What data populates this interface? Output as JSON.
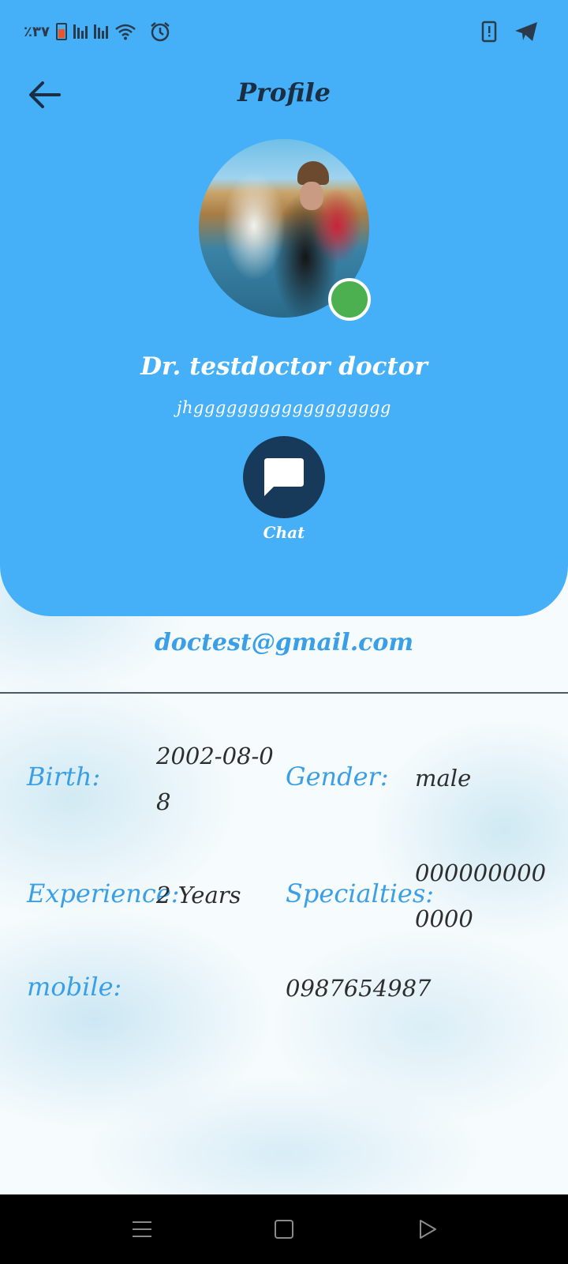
{
  "status_bar": {
    "battery_text": "٪۳۷",
    "icons": [
      "battery-icon",
      "signal-icon",
      "signal-icon",
      "wifi-icon",
      "alarm-icon",
      "phone-alert-icon",
      "telegram-icon"
    ]
  },
  "header": {
    "title": "Profile",
    "back_icon": "arrow-left-icon"
  },
  "profile": {
    "name": "Dr. testdoctor doctor",
    "bio": "jhgggggggggggggggggg",
    "online_status_color": "#4caf50",
    "chat_label": "Chat",
    "email": "doctest@gmail.com"
  },
  "details": {
    "birth_label": "Birth:",
    "birth_value": "2002-08-08",
    "gender_label": "Gender:",
    "gender_value": "male",
    "experience_label": "Experience:",
    "experience_value": "2 Years",
    "specialties_label": "Specialties:",
    "specialties_value": "0000000000000",
    "mobile_label": "mobile:",
    "mobile_value": "0987654987"
  },
  "colors": {
    "header_blue": "#45b0f8",
    "accent_text": "#3a9fe6",
    "chat_button": "#173a5a"
  },
  "nav_bar": {
    "icons": [
      "menu-icon",
      "home-square-icon",
      "back-triangle-icon"
    ]
  }
}
